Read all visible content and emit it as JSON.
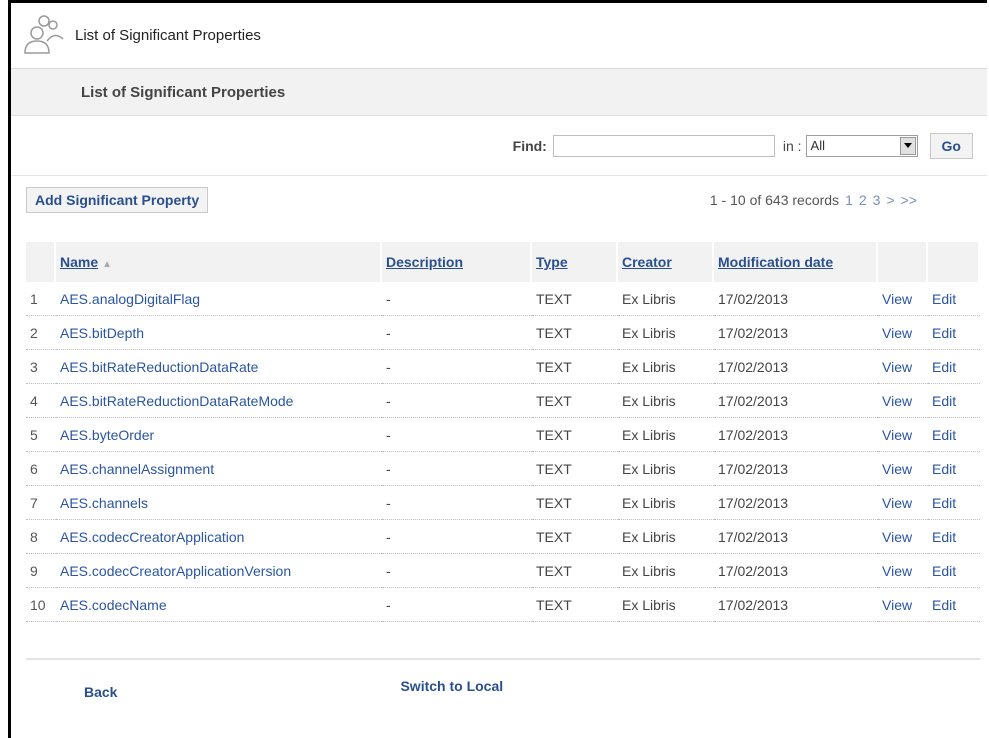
{
  "header": {
    "app_title": "List of Significant Properties"
  },
  "subheader": {
    "title": "List of Significant Properties"
  },
  "search": {
    "find_label": "Find:",
    "query": "",
    "in_label": "in :",
    "in_value": "All",
    "go_label": "Go"
  },
  "actions": {
    "add_label": "Add Significant Property"
  },
  "pagination": {
    "summary": "1 - 10 of 643 records",
    "pages": [
      "1",
      "2",
      "3"
    ],
    "next": ">",
    "last": ">>"
  },
  "table": {
    "columns": [
      "Name",
      "Description",
      "Type",
      "Creator",
      "Modification date"
    ],
    "rows": [
      {
        "num": "1",
        "name": "AES.analogDigitalFlag",
        "description": "-",
        "type": "TEXT",
        "creator": "Ex Libris",
        "date": "17/02/2013",
        "view": "View",
        "edit": "Edit"
      },
      {
        "num": "2",
        "name": "AES.bitDepth",
        "description": "-",
        "type": "TEXT",
        "creator": "Ex Libris",
        "date": "17/02/2013",
        "view": "View",
        "edit": "Edit"
      },
      {
        "num": "3",
        "name": "AES.bitRateReductionDataRate",
        "description": "-",
        "type": "TEXT",
        "creator": "Ex Libris",
        "date": "17/02/2013",
        "view": "View",
        "edit": "Edit"
      },
      {
        "num": "4",
        "name": "AES.bitRateReductionDataRateMode",
        "description": "-",
        "type": "TEXT",
        "creator": "Ex Libris",
        "date": "17/02/2013",
        "view": "View",
        "edit": "Edit"
      },
      {
        "num": "5",
        "name": "AES.byteOrder",
        "description": "-",
        "type": "TEXT",
        "creator": "Ex Libris",
        "date": "17/02/2013",
        "view": "View",
        "edit": "Edit"
      },
      {
        "num": "6",
        "name": "AES.channelAssignment",
        "description": "-",
        "type": "TEXT",
        "creator": "Ex Libris",
        "date": "17/02/2013",
        "view": "View",
        "edit": "Edit"
      },
      {
        "num": "7",
        "name": "AES.channels",
        "description": "-",
        "type": "TEXT",
        "creator": "Ex Libris",
        "date": "17/02/2013",
        "view": "View",
        "edit": "Edit"
      },
      {
        "num": "8",
        "name": "AES.codecCreatorApplication",
        "description": "-",
        "type": "TEXT",
        "creator": "Ex Libris",
        "date": "17/02/2013",
        "view": "View",
        "edit": "Edit"
      },
      {
        "num": "9",
        "name": "AES.codecCreatorApplicationVersion",
        "description": "-",
        "type": "TEXT",
        "creator": "Ex Libris",
        "date": "17/02/2013",
        "view": "View",
        "edit": "Edit"
      },
      {
        "num": "10",
        "name": "AES.codecName",
        "description": "-",
        "type": "TEXT",
        "creator": "Ex Libris",
        "date": "17/02/2013",
        "view": "View",
        "edit": "Edit"
      }
    ]
  },
  "footer": {
    "back_label": "Back",
    "switch_label": "Switch to Local"
  },
  "icons": {
    "logo": "users-group-icon",
    "sort": "sort-asc-icon",
    "dropdown": "dropdown-arrow-icon"
  },
  "colors": {
    "link": "#2a55a3",
    "header_bg": "#f2f2f2"
  }
}
